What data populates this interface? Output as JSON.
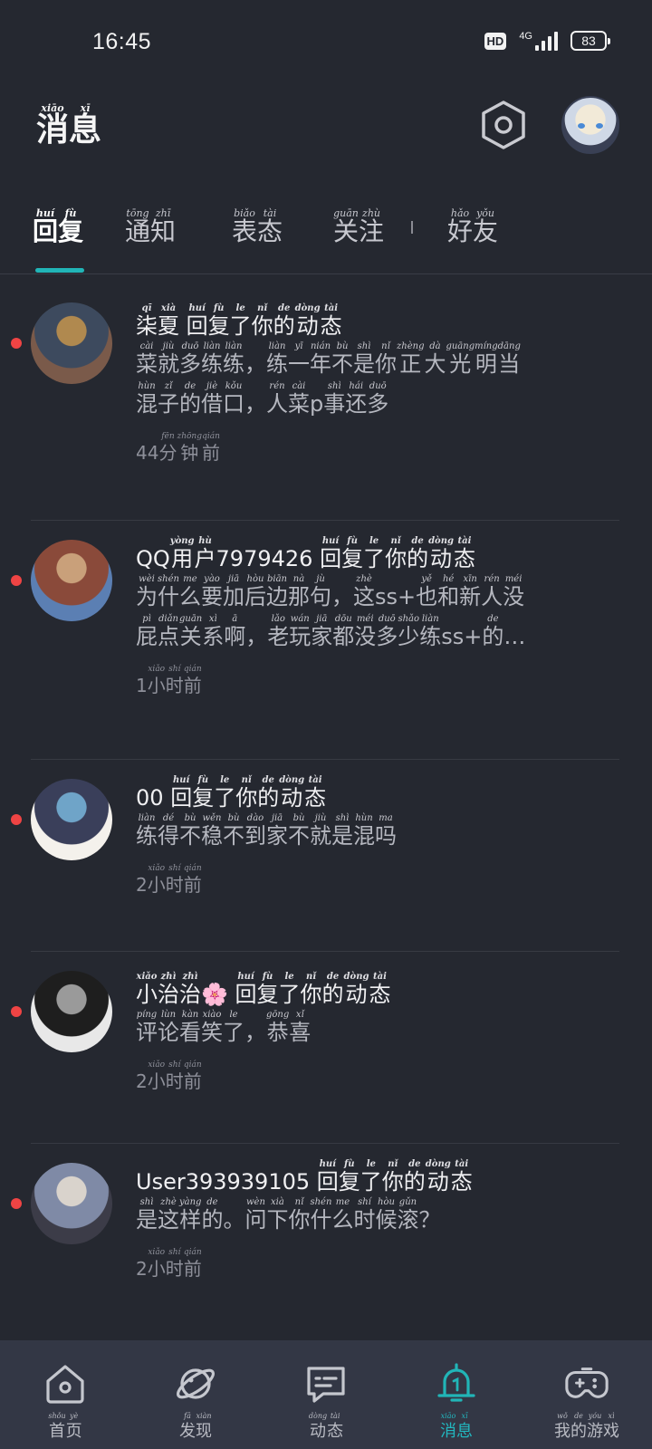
{
  "status": {
    "time": "16:45",
    "hd": "HD",
    "network": "4G",
    "battery": "83"
  },
  "header": {
    "title": [
      {
        "c": "消",
        "p": "xiāo"
      },
      {
        "c": "息",
        "p": "xī"
      }
    ],
    "settings_icon": "hexagon-settings-icon",
    "avatar": "user-avatar"
  },
  "tabs": [
    {
      "chars": [
        {
          "c": "回",
          "p": "huí"
        },
        {
          "c": "复",
          "p": "fù"
        }
      ],
      "active": true
    },
    {
      "chars": [
        {
          "c": "通",
          "p": "tōng"
        },
        {
          "c": "知",
          "p": "zhī"
        }
      ],
      "active": false
    },
    {
      "chars": [
        {
          "c": "表",
          "p": "biǎo"
        },
        {
          "c": "态",
          "p": "tài"
        }
      ],
      "active": false
    },
    {
      "chars": [
        {
          "c": "关",
          "p": "guān"
        },
        {
          "c": "注",
          "p": "zhù"
        }
      ],
      "active": false
    },
    {
      "chars": [
        {
          "c": "好",
          "p": "hǎo"
        },
        {
          "c": "友",
          "p": "yǒu"
        }
      ],
      "active": false
    }
  ],
  "accent_color": "#21b5b7",
  "unread_color": "#ef4444",
  "messages": [
    {
      "title": [
        {
          "c": "柒",
          "p": "qī"
        },
        {
          "c": "夏",
          "p": "xià"
        },
        {
          "c": " ",
          "p": ""
        },
        {
          "c": "回",
          "p": "huí"
        },
        {
          "c": "复",
          "p": "fù"
        },
        {
          "c": "了",
          "p": "le"
        },
        {
          "c": "你",
          "p": "nǐ"
        },
        {
          "c": "的",
          "p": "de"
        },
        {
          "c": "动",
          "p": "dòng"
        },
        {
          "c": "态",
          "p": "tài"
        }
      ],
      "lines": [
        [
          {
            "c": "菜",
            "p": "cài"
          },
          {
            "c": "就",
            "p": "jiù"
          },
          {
            "c": "多",
            "p": "duō"
          },
          {
            "c": "练",
            "p": "liàn"
          },
          {
            "c": "练",
            "p": "liàn"
          },
          {
            "c": "，",
            "p": ""
          },
          {
            "c": "练",
            "p": "liàn"
          },
          {
            "c": "一",
            "p": "yī"
          },
          {
            "c": "年",
            "p": "nián"
          },
          {
            "c": "不",
            "p": "bù"
          },
          {
            "c": "是",
            "p": "shì"
          },
          {
            "c": "你",
            "p": "nǐ"
          },
          {
            "c": "正",
            "p": "zhèng"
          },
          {
            "c": "大",
            "p": "dà"
          },
          {
            "c": "光",
            "p": "guāng"
          },
          {
            "c": "明",
            "p": "míng"
          },
          {
            "c": "当",
            "p": "dāng"
          }
        ],
        [
          {
            "c": "混",
            "p": "hùn"
          },
          {
            "c": "子",
            "p": "zǐ"
          },
          {
            "c": "的",
            "p": "de"
          },
          {
            "c": "借",
            "p": "jiè"
          },
          {
            "c": "口",
            "p": "kǒu"
          },
          {
            "c": "，",
            "p": ""
          },
          {
            "c": "人",
            "p": "rén"
          },
          {
            "c": "菜",
            "p": "cài"
          },
          {
            "c": "p",
            "p": ""
          },
          {
            "c": "事",
            "p": "shì"
          },
          {
            "c": "还",
            "p": "hái"
          },
          {
            "c": "多",
            "p": "duō"
          }
        ]
      ],
      "time": [
        {
          "c": "44",
          "p": ""
        },
        {
          "c": "分",
          "p": "fēn"
        },
        {
          "c": "钟",
          "p": "zhōng"
        },
        {
          "c": "前",
          "p": "qián"
        }
      ],
      "avatar_colors": [
        "#7a5a4a",
        "#3d4a5e",
        "#b0894f"
      ]
    },
    {
      "title": [
        {
          "c": "QQ",
          "p": ""
        },
        {
          "c": "用",
          "p": "yòng"
        },
        {
          "c": "户",
          "p": "hù"
        },
        {
          "c": "7979426",
          "p": ""
        },
        {
          "c": " ",
          "p": ""
        },
        {
          "c": "回",
          "p": "huí"
        },
        {
          "c": "复",
          "p": "fù"
        },
        {
          "c": "了",
          "p": "le"
        },
        {
          "c": "你",
          "p": "nǐ"
        },
        {
          "c": "的",
          "p": "de"
        },
        {
          "c": "动",
          "p": "dòng"
        },
        {
          "c": "态",
          "p": "tài"
        }
      ],
      "lines": [
        [
          {
            "c": "为",
            "p": "wèi"
          },
          {
            "c": "什",
            "p": "shén"
          },
          {
            "c": "么",
            "p": "me"
          },
          {
            "c": "要",
            "p": "yào"
          },
          {
            "c": "加",
            "p": "jiā"
          },
          {
            "c": "后",
            "p": "hòu"
          },
          {
            "c": "边",
            "p": "biān"
          },
          {
            "c": "那",
            "p": "nà"
          },
          {
            "c": "句",
            "p": "jù"
          },
          {
            "c": "，",
            "p": ""
          },
          {
            "c": "这",
            "p": "zhè"
          },
          {
            "c": "ss+",
            "p": ""
          },
          {
            "c": "也",
            "p": "yě"
          },
          {
            "c": "和",
            "p": "hé"
          },
          {
            "c": "新",
            "p": "xīn"
          },
          {
            "c": "人",
            "p": "rén"
          },
          {
            "c": "没",
            "p": "méi"
          }
        ],
        [
          {
            "c": "屁",
            "p": "pì"
          },
          {
            "c": "点",
            "p": "diǎn"
          },
          {
            "c": "关",
            "p": "guān"
          },
          {
            "c": "系",
            "p": "xì"
          },
          {
            "c": "啊",
            "p": "ā"
          },
          {
            "c": "，",
            "p": ""
          },
          {
            "c": "老",
            "p": "lǎo"
          },
          {
            "c": "玩",
            "p": "wán"
          },
          {
            "c": "家",
            "p": "jiā"
          },
          {
            "c": "都",
            "p": "dōu"
          },
          {
            "c": "没",
            "p": "méi"
          },
          {
            "c": "多",
            "p": "duō"
          },
          {
            "c": "少",
            "p": "shǎo"
          },
          {
            "c": "练",
            "p": "liàn"
          },
          {
            "c": "ss+",
            "p": ""
          },
          {
            "c": "的",
            "p": "de"
          },
          {
            "c": "…",
            "p": ""
          }
        ]
      ],
      "time": [
        {
          "c": "1",
          "p": ""
        },
        {
          "c": "小",
          "p": "xiǎo"
        },
        {
          "c": "时",
          "p": "shí"
        },
        {
          "c": "前",
          "p": "qián"
        }
      ],
      "avatar_colors": [
        "#5b7fb3",
        "#8a4a3a",
        "#c9a07a"
      ]
    },
    {
      "title": [
        {
          "c": "00",
          "p": ""
        },
        {
          "c": " ",
          "p": ""
        },
        {
          "c": "回",
          "p": "huí"
        },
        {
          "c": "复",
          "p": "fù"
        },
        {
          "c": "了",
          "p": "le"
        },
        {
          "c": "你",
          "p": "nǐ"
        },
        {
          "c": "的",
          "p": "de"
        },
        {
          "c": "动",
          "p": "dòng"
        },
        {
          "c": "态",
          "p": "tài"
        }
      ],
      "lines": [
        [
          {
            "c": "练",
            "p": "liàn"
          },
          {
            "c": "得",
            "p": "dé"
          },
          {
            "c": "不",
            "p": "bù"
          },
          {
            "c": "稳",
            "p": "wěn"
          },
          {
            "c": "不",
            "p": "bù"
          },
          {
            "c": "到",
            "p": "dào"
          },
          {
            "c": "家",
            "p": "jiā"
          },
          {
            "c": "不",
            "p": "bù"
          },
          {
            "c": "就",
            "p": "jiù"
          },
          {
            "c": "是",
            "p": "shì"
          },
          {
            "c": "混",
            "p": "hùn"
          },
          {
            "c": "吗",
            "p": "ma"
          }
        ]
      ],
      "time": [
        {
          "c": "2",
          "p": ""
        },
        {
          "c": "小",
          "p": "xiǎo"
        },
        {
          "c": "时",
          "p": "shí"
        },
        {
          "c": "前",
          "p": "qián"
        }
      ],
      "avatar_colors": [
        "#f4f1ec",
        "#3a3f5a",
        "#6fa4c8"
      ]
    },
    {
      "title": [
        {
          "c": "小",
          "p": "xiǎo"
        },
        {
          "c": "治",
          "p": "zhì"
        },
        {
          "c": "治",
          "p": "zhì"
        },
        {
          "c": "🌸",
          "p": ""
        },
        {
          "c": " ",
          "p": ""
        },
        {
          "c": "回",
          "p": "huí"
        },
        {
          "c": "复",
          "p": "fù"
        },
        {
          "c": "了",
          "p": "le"
        },
        {
          "c": "你",
          "p": "nǐ"
        },
        {
          "c": "的",
          "p": "de"
        },
        {
          "c": "动",
          "p": "dòng"
        },
        {
          "c": "态",
          "p": "tài"
        }
      ],
      "lines": [
        [
          {
            "c": "评",
            "p": "píng"
          },
          {
            "c": "论",
            "p": "lùn"
          },
          {
            "c": "看",
            "p": "kàn"
          },
          {
            "c": "笑",
            "p": "xiào"
          },
          {
            "c": "了",
            "p": "le"
          },
          {
            "c": "，",
            "p": ""
          },
          {
            "c": "恭",
            "p": "gōng"
          },
          {
            "c": "喜",
            "p": "xǐ"
          }
        ]
      ],
      "time": [
        {
          "c": "2",
          "p": ""
        },
        {
          "c": "小",
          "p": "xiǎo"
        },
        {
          "c": "时",
          "p": "shí"
        },
        {
          "c": "前",
          "p": "qián"
        }
      ],
      "avatar_colors": [
        "#e8e8e8",
        "#1e1e1e",
        "#9a9a9a"
      ]
    },
    {
      "title": [
        {
          "c": "User393939105",
          "p": ""
        },
        {
          "c": " ",
          "p": ""
        },
        {
          "c": "回",
          "p": "huí"
        },
        {
          "c": "复",
          "p": "fù"
        },
        {
          "c": "了",
          "p": "le"
        },
        {
          "c": "你",
          "p": "nǐ"
        },
        {
          "c": "的",
          "p": "de"
        },
        {
          "c": "动",
          "p": "dòng"
        },
        {
          "c": "态",
          "p": "tài"
        }
      ],
      "lines": [
        [
          {
            "c": "是",
            "p": "shì"
          },
          {
            "c": "这",
            "p": "zhè"
          },
          {
            "c": "样",
            "p": "yàng"
          },
          {
            "c": "的",
            "p": "de"
          },
          {
            "c": "。",
            "p": ""
          },
          {
            "c": "问",
            "p": "wèn"
          },
          {
            "c": "下",
            "p": "xià"
          },
          {
            "c": "你",
            "p": "nǐ"
          },
          {
            "c": "什",
            "p": "shén"
          },
          {
            "c": "么",
            "p": "me"
          },
          {
            "c": "时",
            "p": "shí"
          },
          {
            "c": "候",
            "p": "hòu"
          },
          {
            "c": "滚",
            "p": "gǔn"
          },
          {
            "c": "？",
            "p": ""
          }
        ]
      ],
      "time": [
        {
          "c": "2",
          "p": ""
        },
        {
          "c": "小",
          "p": "xiǎo"
        },
        {
          "c": "时",
          "p": "shí"
        },
        {
          "c": "前",
          "p": "qián"
        }
      ],
      "avatar_colors": [
        "#3c3c48",
        "#7f8aa6",
        "#d9d3cc"
      ]
    }
  ],
  "bottom_nav": [
    {
      "icon": "home-icon",
      "chars": [
        {
          "c": "首",
          "p": "shǒu"
        },
        {
          "c": "页",
          "p": "yè"
        }
      ],
      "active": false
    },
    {
      "icon": "planet-icon",
      "chars": [
        {
          "c": "发",
          "p": "fā"
        },
        {
          "c": "现",
          "p": "xiàn"
        }
      ],
      "active": false
    },
    {
      "icon": "chat-icon",
      "chars": [
        {
          "c": "动",
          "p": "dòng"
        },
        {
          "c": "态",
          "p": "tài"
        }
      ],
      "active": false
    },
    {
      "icon": "bell-icon",
      "chars": [
        {
          "c": "消",
          "p": "xiāo"
        },
        {
          "c": "息",
          "p": "xī"
        }
      ],
      "active": true
    },
    {
      "icon": "gamepad-icon",
      "chars": [
        {
          "c": "我",
          "p": "wǒ"
        },
        {
          "c": "的",
          "p": "de"
        },
        {
          "c": "游",
          "p": "yóu"
        },
        {
          "c": "戏",
          "p": "xì"
        }
      ],
      "active": false
    }
  ]
}
